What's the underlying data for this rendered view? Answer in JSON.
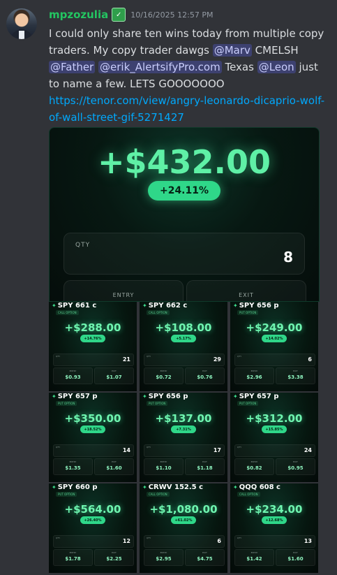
{
  "author": {
    "username": "mpzozulia",
    "badge_icon": "server-badge-icon",
    "timestamp": "10/16/2025 12:57 PM"
  },
  "message": {
    "text_1": "I could only share ten wins today from multiple copy traders. My copy trader dawgs ",
    "mention_1": "@Marv",
    "text_2": " CMELSH ",
    "mention_2": "@Father",
    "text_3": " ",
    "mention_3": "@erik_AlertsifyPro.com",
    "text_4": " Texas ",
    "mention_4": "@Leon",
    "text_5": " just to name a few. LETS GOOOOOOO",
    "link": "https://tenor.com/view/angry-leonardo-dicaprio-wolf-of-wall-street-gif-5271427"
  },
  "main_embed": {
    "amount": "+$432.00",
    "percent": "+24.11%",
    "qty_label": "QTY",
    "qty_value": "8",
    "entry_label": "ENTRY",
    "exit_label": "EXIT"
  },
  "cards": [
    {
      "title": "SPY 661 c",
      "tag": "CALL OPTION",
      "amount": "+$288.00",
      "percent": "+14.76%",
      "qty_label": "QTY",
      "qty": "21",
      "entry_label": "ENTRY",
      "entry": "$0.93",
      "exit_label": "EXIT",
      "exit": "$1.07"
    },
    {
      "title": "SPY 662 c",
      "tag": "CALL OPTION",
      "amount": "+$108.00",
      "percent": "+5.17%",
      "qty_label": "QTY",
      "qty": "29",
      "entry_label": "ENTRY",
      "entry": "$0.72",
      "exit_label": "EXIT",
      "exit": "$0.76"
    },
    {
      "title": "SPY 656 p",
      "tag": "PUT OPTION",
      "amount": "+$249.00",
      "percent": "+14.02%",
      "qty_label": "QTY",
      "qty": "6",
      "entry_label": "ENTRY",
      "entry": "$2.96",
      "exit_label": "EXIT",
      "exit": "$3.38"
    },
    {
      "title": "SPY 657 p",
      "tag": "PUT OPTION",
      "amount": "+$350.00",
      "percent": "+18.52%",
      "qty_label": "QTY",
      "qty": "14",
      "entry_label": "ENTRY",
      "entry": "$1.35",
      "exit_label": "EXIT",
      "exit": "$1.60"
    },
    {
      "title": "SPY 656 p",
      "tag": "PUT OPTION",
      "amount": "+$137.00",
      "percent": "+7.31%",
      "qty_label": "QTY",
      "qty": "17",
      "entry_label": "ENTRY",
      "entry": "$1.10",
      "exit_label": "EXIT",
      "exit": "$1.18"
    },
    {
      "title": "SPY 657 p",
      "tag": "PUT OPTION",
      "amount": "+$312.00",
      "percent": "+15.85%",
      "qty_label": "QTY",
      "qty": "24",
      "entry_label": "ENTRY",
      "entry": "$0.82",
      "exit_label": "EXIT",
      "exit": "$0.95"
    },
    {
      "title": "SPY 660 p",
      "tag": "PUT OPTION",
      "amount": "+$564.00",
      "percent": "+26.40%",
      "qty_label": "QTY",
      "qty": "12",
      "entry_label": "ENTRY",
      "entry": "$1.78",
      "exit_label": "EXIT",
      "exit": "$2.25"
    },
    {
      "title": "CRWV 152.5 c",
      "tag": "CALL OPTION",
      "amount": "+$1,080.00",
      "percent": "+61.02%",
      "qty_label": "QTY",
      "qty": "6",
      "entry_label": "ENTRY",
      "entry": "$2.95",
      "exit_label": "EXIT",
      "exit": "$4.75"
    },
    {
      "title": "QQQ 608 c",
      "tag": "CALL OPTION",
      "amount": "+$234.00",
      "percent": "+12.68%",
      "qty_label": "QTY",
      "qty": "13",
      "entry_label": "ENTRY",
      "entry": "$1.42",
      "exit_label": "EXIT",
      "exit": "$1.60"
    }
  ],
  "colors": {
    "username": "#23c561",
    "mention_bg": "#4752c4",
    "link": "#00a8fc",
    "profit_green": "#5ff0a6",
    "pill_green": "#2fd789",
    "background": "#313338"
  }
}
